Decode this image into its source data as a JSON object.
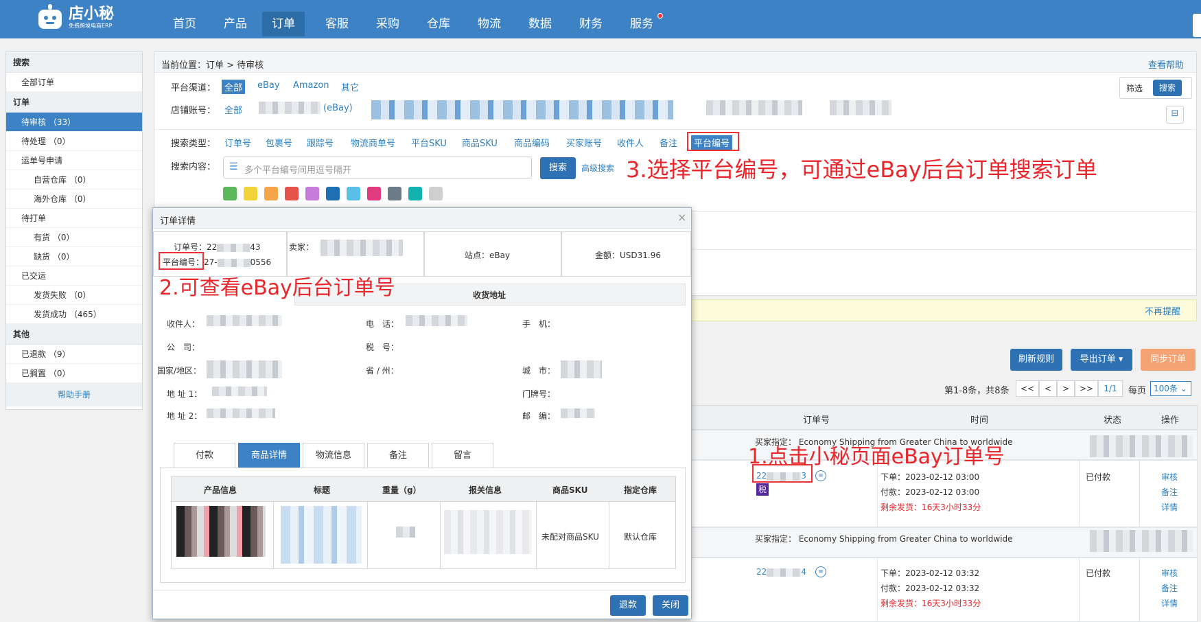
{
  "header": {
    "logo_text": "店小秘",
    "logo_sub": "免费跨境电商ERP",
    "nav": [
      "首页",
      "产品",
      "订单",
      "客服",
      "采购",
      "仓库",
      "物流",
      "数据",
      "财务",
      "服务"
    ],
    "active_nav": "订单"
  },
  "sidebar": {
    "search_head": "搜索",
    "all_orders": "全部订单",
    "order_head": "订单",
    "items": [
      {
        "label": "待审核 （33）",
        "level": 1,
        "active": true
      },
      {
        "label": "待处理 （0）",
        "level": 1
      },
      {
        "label": "运单号申请",
        "level": 1
      },
      {
        "label": "自营仓库 （0）",
        "level": 2
      },
      {
        "label": "海外仓库 （0）",
        "level": 2
      },
      {
        "label": "待打单",
        "level": 1
      },
      {
        "label": "有货 （0）",
        "level": 2
      },
      {
        "label": "缺货 （0）",
        "level": 2
      },
      {
        "label": "已交运",
        "level": 1
      },
      {
        "label": "发货失败 （0）",
        "level": 2
      },
      {
        "label": "发货成功 （465）",
        "level": 2
      }
    ],
    "other_head": "其他",
    "other_items": [
      "已退款 （9）",
      "已搁置 （0）"
    ],
    "help": "帮助手册"
  },
  "main": {
    "breadcrumb_label": "当前位置：",
    "breadcrumb": "订单 > 待审核",
    "help_link": "查看帮助",
    "platform_label": "平台渠道：",
    "platforms": [
      "全部",
      "eBay",
      "Amazon",
      "其它"
    ],
    "store_label": "店铺账号：",
    "store_all": "全部",
    "store_ebay": "(eBay)",
    "filter_btn": "筛选",
    "search_btn": "搜索",
    "search_type_label": "搜索类型：",
    "search_types": [
      "订单号",
      "包裹号",
      "跟踪号",
      "物流商单号",
      "平台SKU",
      "商品SKU",
      "商品编码",
      "买家账号",
      "收件人",
      "备注",
      "平台编号"
    ],
    "search_content_label": "搜索内容：",
    "search_placeholder": "多个平台编号间用逗号隔开",
    "search_button": "搜索",
    "advanced_search": "高级搜索",
    "tag_colors": [
      "#5cb85c",
      "#f0d43a",
      "#f7a54a",
      "#e5534b",
      "#c77ddc",
      "#1f6fb5",
      "#5bc0e8",
      "#e23a7e",
      "#6b7c86",
      "#12b2b0",
      "#cfcfcf"
    ],
    "notice_dismiss": "不再提醒",
    "refresh_rules": "刷新规则",
    "export_orders": "导出订单",
    "sync_orders": "同步订单",
    "paging": {
      "summary": "第1-8条，共8条",
      "first": "<<",
      "prev": "<",
      "next": ">",
      "last": ">>",
      "page": "1/1",
      "per_page_label": "每页",
      "per_page": "100条"
    },
    "table_headers": [
      "订单号",
      "时间",
      "状态",
      "操作"
    ],
    "orders": [
      {
        "buyer_spec": "买家指定：  Economy Shipping from Greater China to worldwide",
        "order_no_a": "22",
        "order_no_b": "3",
        "tax": "税",
        "ordered": "下单：2023-02-12 03:00",
        "paid": "付款：2023-02-12 03:00",
        "remaining_label": "剩余发货：",
        "remaining": "16天3小时33分",
        "status": "已付款",
        "actions": [
          "审核",
          "备注",
          "详情"
        ]
      },
      {
        "buyer_spec": "买家指定：  Economy Shipping from Greater China to worldwide",
        "order_no_a": "22",
        "order_no_b": "4",
        "ordered": "下单：2023-02-12 03:32",
        "paid": "付款：2023-02-12 03:32",
        "remaining_label": "剩余发货：",
        "remaining": "16天3小时33分",
        "status": "已付款",
        "actions": [
          "审核",
          "备注",
          "详情"
        ]
      }
    ]
  },
  "modal": {
    "title": "订单详情",
    "close": "×",
    "order_no_label": "订单号：",
    "order_no_a": "22",
    "order_no_b": "43",
    "platform_no_label": "平台编号：",
    "platform_no_a": "27-",
    "platform_no_b": "0556",
    "seller_label": "卖家：",
    "site_label": "站点：",
    "site": "eBay",
    "amount_label": "金额：",
    "amount": "USD31.96",
    "address_title": "收货地址",
    "fields": {
      "recipient": "收件人：",
      "phone": "电　话：",
      "mobile": "手　机：",
      "company": "公　司：",
      "tax_no": "税　号：",
      "country": "国家/地区：",
      "province": "省 / 州：",
      "city": "城　市：",
      "address1": "地 址 1：",
      "door_no": "门牌号：",
      "address2": "地 址 2：",
      "zip": "邮　编："
    },
    "tabs": [
      "付款",
      "商品详情",
      "物流信息",
      "备注",
      "留言"
    ],
    "active_tab": "商品详情",
    "product_headers": [
      "产品信息",
      "标题",
      "重量（g）",
      "报关信息",
      "商品SKU",
      "指定仓库"
    ],
    "product_row": {
      "sku": "未配对商品SKU",
      "warehouse": "默认仓库"
    },
    "refund_btn": "退款",
    "close_btn": "关闭"
  },
  "annotations": {
    "step1": "1.点击小秘页面eBay订单号",
    "step2": "2.可查看eBay后台订单号",
    "step3": "3.选择平台编号，可通过eBay后台订单搜索订单"
  }
}
